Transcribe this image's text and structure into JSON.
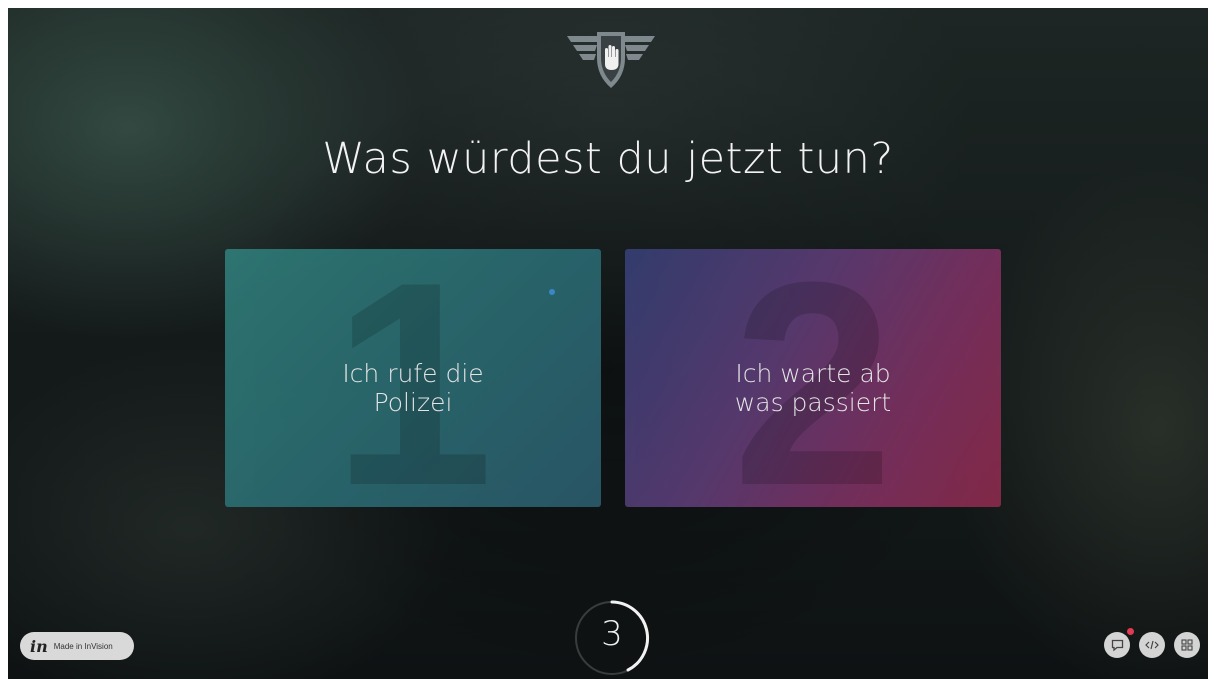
{
  "screen": {
    "title": "Was würdest du jetzt tun?"
  },
  "emblem": {
    "icon": "hand-shield-emblem-icon"
  },
  "options": [
    {
      "number": "1",
      "label": "Ich rufe die\nPolizei",
      "color_start": "#2f7a76",
      "color_end": "#2b5a6b"
    },
    {
      "number": "2",
      "label": "Ich warte ab\nwas passiert",
      "color_start": "#343f73",
      "color_end": "#8a2a4a"
    }
  ],
  "timer": {
    "value": "3"
  },
  "invision_badge": {
    "logo": "in",
    "label": "Made in InVision"
  },
  "controls": [
    {
      "name": "comment-button",
      "icon": "comment-icon"
    },
    {
      "name": "code-button",
      "icon": "code-icon"
    },
    {
      "name": "grid-button",
      "icon": "grid-icon"
    }
  ],
  "colors": {
    "notification": "#e23a52",
    "accent_dot": "#3d8fd8"
  }
}
